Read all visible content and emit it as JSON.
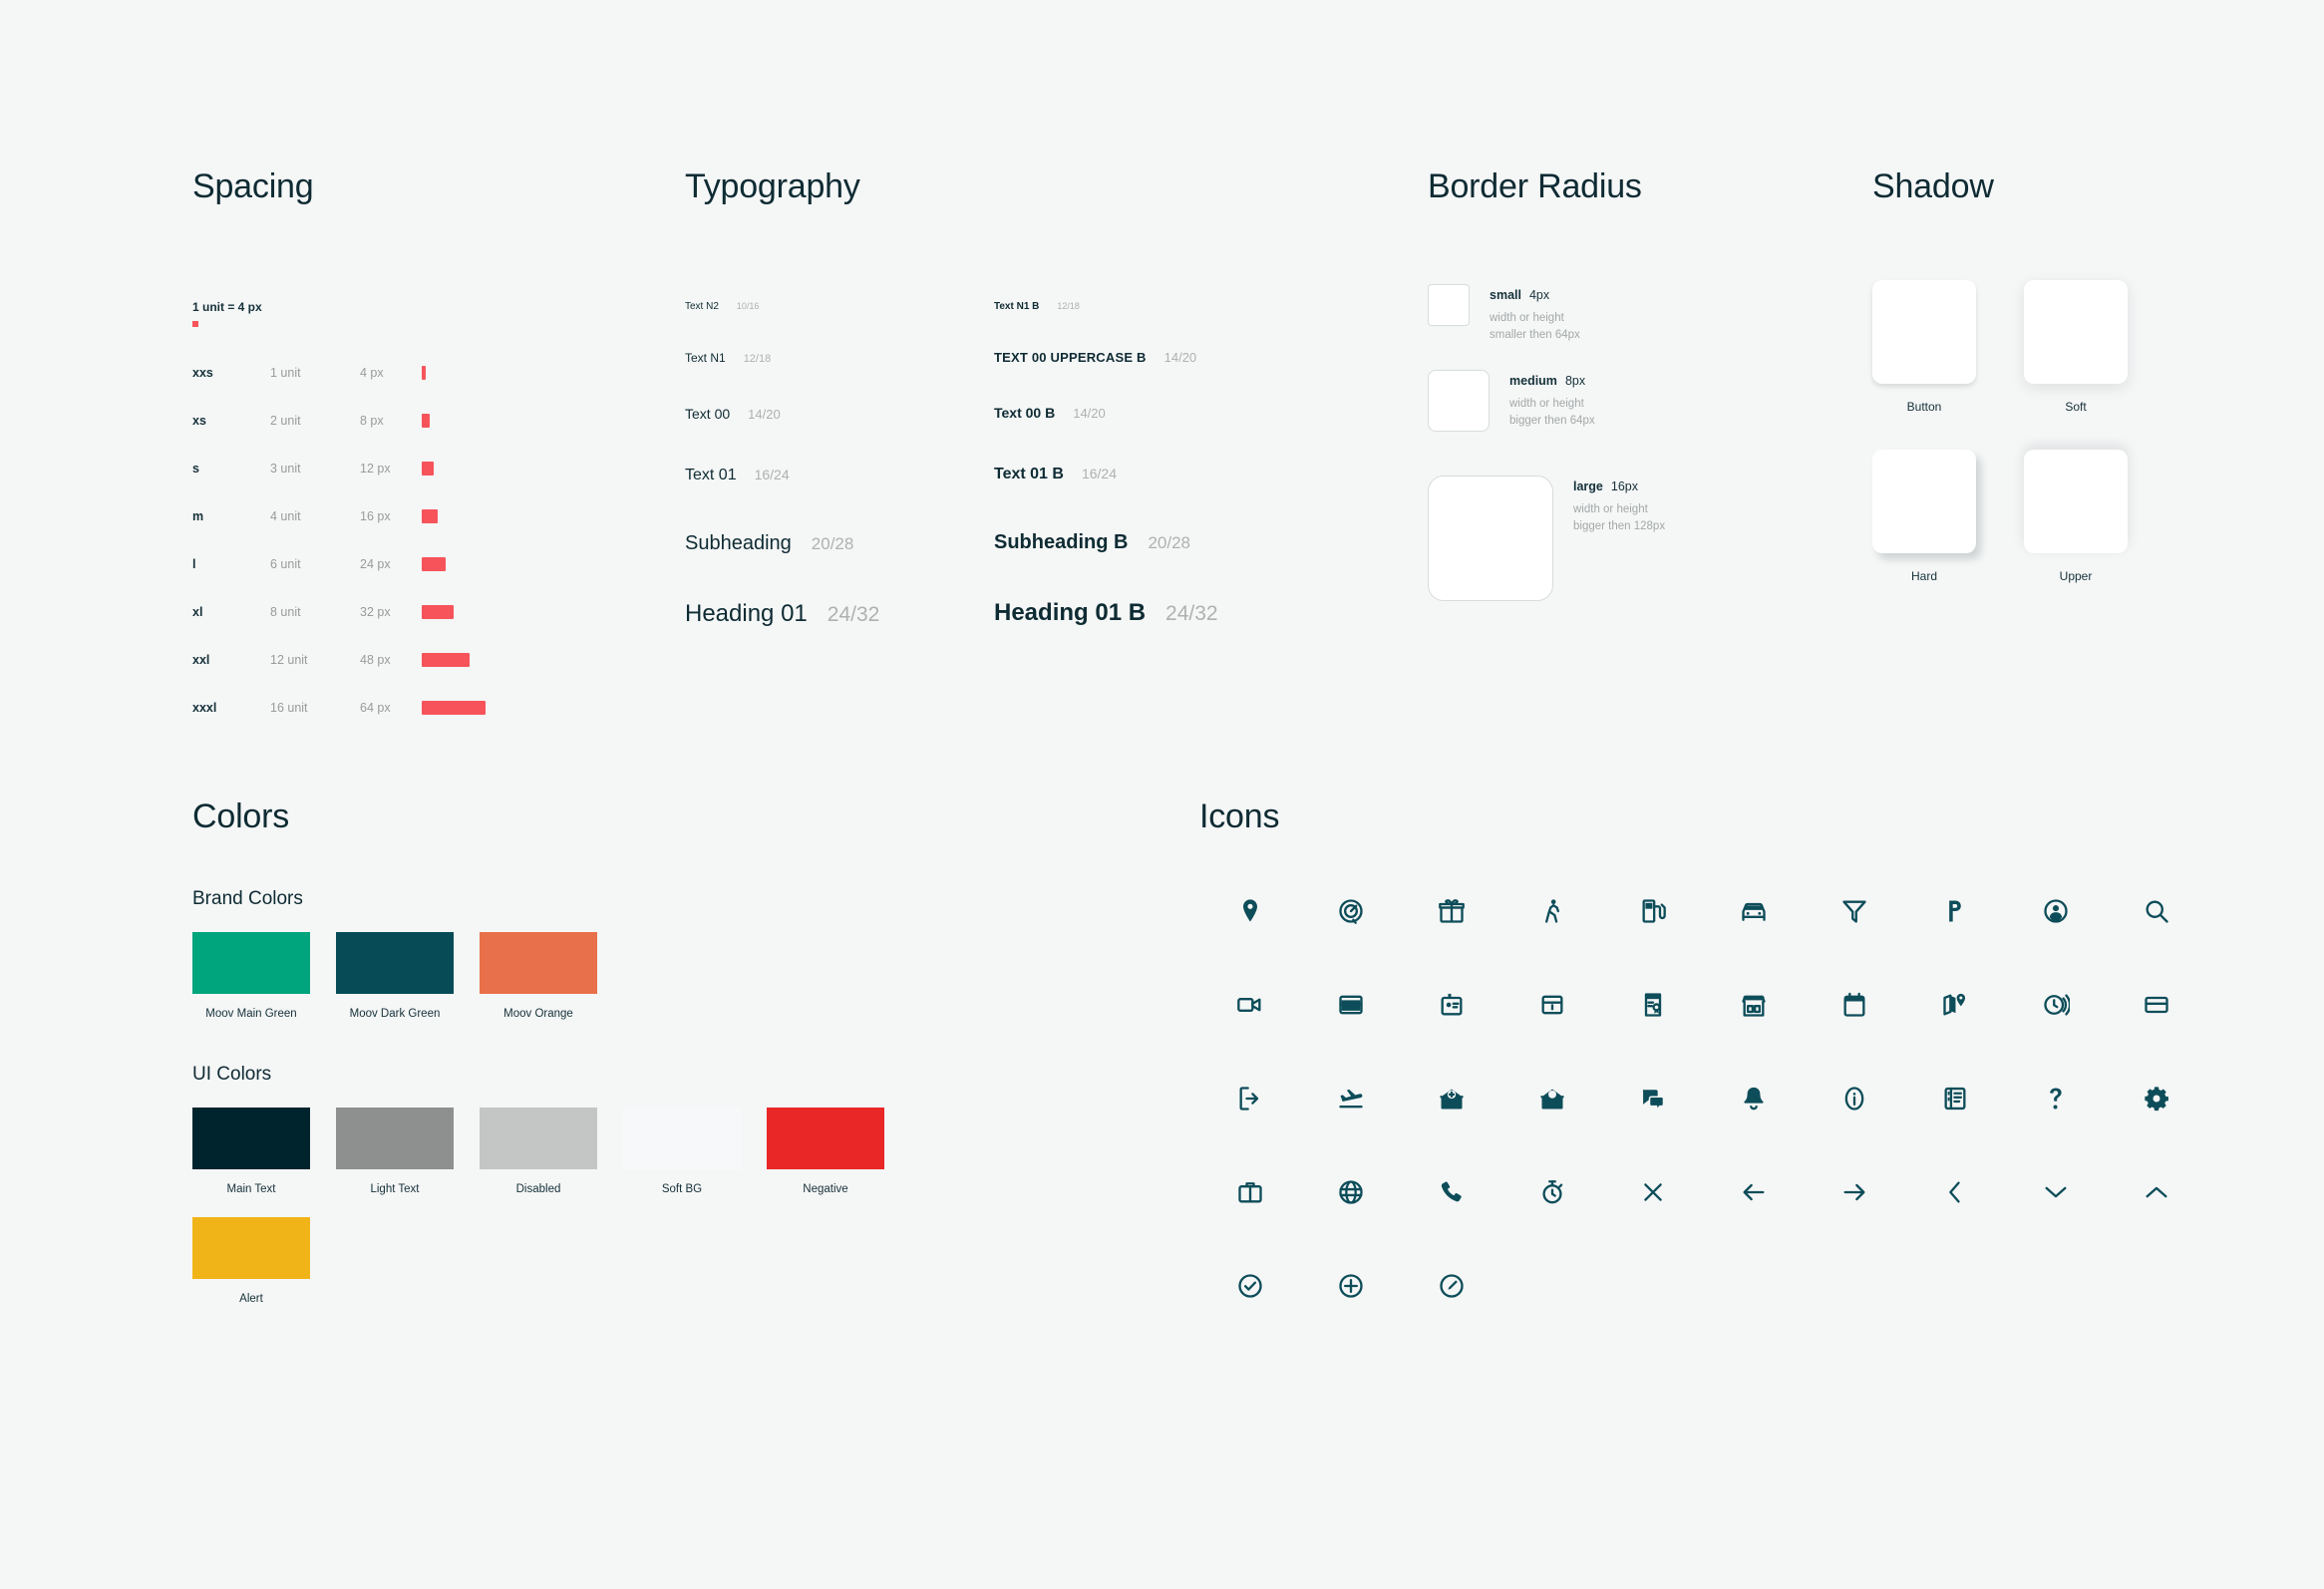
{
  "sections": {
    "spacing": "Spacing",
    "typography": "Typography",
    "border_radius": "Border Radius",
    "shadow": "Shadow",
    "colors": "Colors",
    "icons": "Icons"
  },
  "spacing": {
    "unit_note": "1 unit = 4 px",
    "accent_color": "#f6545a",
    "rows": [
      {
        "name": "xxs",
        "unit": "1 unit",
        "px": "4 px",
        "bar": 4
      },
      {
        "name": "xs",
        "unit": "2 unit",
        "px": "8 px",
        "bar": 8
      },
      {
        "name": "s",
        "unit": "3 unit",
        "px": "12 px",
        "bar": 12
      },
      {
        "name": "m",
        "unit": "4 unit",
        "px": "16 px",
        "bar": 16
      },
      {
        "name": "l",
        "unit": "6 unit",
        "px": "24 px",
        "bar": 24
      },
      {
        "name": "xl",
        "unit": "8 unit",
        "px": "32 px",
        "bar": 32
      },
      {
        "name": "xxl",
        "unit": "12 unit",
        "px": "48 px",
        "bar": 48
      },
      {
        "name": "xxxl",
        "unit": "16 unit",
        "px": "64 px",
        "bar": 64
      }
    ]
  },
  "typography": {
    "regular": [
      {
        "label": "Text N2",
        "size": "10/16"
      },
      {
        "label": "Text N1",
        "size": "12/18"
      },
      {
        "label": "Text 00",
        "size": "14/20"
      },
      {
        "label": "Text 01",
        "size": "16/24"
      },
      {
        "label": "Subheading",
        "size": "20/28"
      },
      {
        "label": "Heading 01",
        "size": "24/32"
      }
    ],
    "bold": [
      {
        "label": "Text N1 B",
        "size": "12/18"
      },
      {
        "label": "TEXT 00 UPPERCASE B",
        "size": "14/20"
      },
      {
        "label": "Text 00 B",
        "size": "14/20"
      },
      {
        "label": "Text 01 B",
        "size": "16/24"
      },
      {
        "label": "Subheading B",
        "size": "20/28"
      },
      {
        "label": "Heading 01 B",
        "size": "24/32"
      }
    ]
  },
  "border_radius": [
    {
      "name": "small",
      "value": "4px",
      "desc_line1": "width or height",
      "desc_line2": "smaller then 64px"
    },
    {
      "name": "medium",
      "value": "8px",
      "desc_line1": "width or height",
      "desc_line2": "bigger then 64px"
    },
    {
      "name": "large",
      "value": "16px",
      "desc_line1": "width or height",
      "desc_line2": "bigger then 128px"
    }
  ],
  "shadow": [
    {
      "label": "Button"
    },
    {
      "label": "Soft"
    },
    {
      "label": "Hard"
    },
    {
      "label": "Upper"
    }
  ],
  "colors": {
    "brand_title": "Brand Colors",
    "ui_title": "UI Colors",
    "brand": [
      {
        "label": "Moov Main Green",
        "hex": "#00a57d"
      },
      {
        "label": "Moov Dark Green",
        "hex": "#064b56"
      },
      {
        "label": "Moov Orange",
        "hex": "#e8704a"
      }
    ],
    "ui": [
      {
        "label": "Main Text",
        "hex": "#00242e"
      },
      {
        "label": "Light Text",
        "hex": "#8e9090"
      },
      {
        "label": "Disabled",
        "hex": "#c4c6c6"
      },
      {
        "label": "Soft BG",
        "hex": "#f7f8fa"
      },
      {
        "label": "Negative",
        "hex": "#ea2727"
      },
      {
        "label": "Alert",
        "hex": "#f0b418"
      }
    ]
  },
  "icons": {
    "color": "#0d4d59",
    "items": [
      "map-pin-icon",
      "gauge-icon",
      "gift-icon",
      "walking-person-icon",
      "fuel-pump-icon",
      "car-icon",
      "filter-funnel-icon",
      "parking-icon",
      "user-circle-icon",
      "search-icon",
      "video-camera-icon",
      "wallet-icon",
      "id-badge-icon",
      "card-box-icon",
      "certificate-icon",
      "storefront-icon",
      "calendar-icon",
      "map-location-icon",
      "clock-waves-icon",
      "credit-card-icon",
      "logout-icon",
      "plane-landing-icon",
      "mail-add-icon",
      "envelope-open-icon",
      "chat-bubbles-icon",
      "bell-icon",
      "info-circle-icon",
      "contact-list-icon",
      "question-mark-icon",
      "gear-icon",
      "briefcase-icon",
      "globe-icon",
      "phone-icon",
      "stopwatch-icon",
      "close-x-icon",
      "arrow-left-icon",
      "arrow-right-icon",
      "chevron-left-icon",
      "chevron-down-icon",
      "chevron-up-icon",
      "check-circle-icon",
      "plus-circle-icon",
      "edit-circle-icon"
    ]
  }
}
